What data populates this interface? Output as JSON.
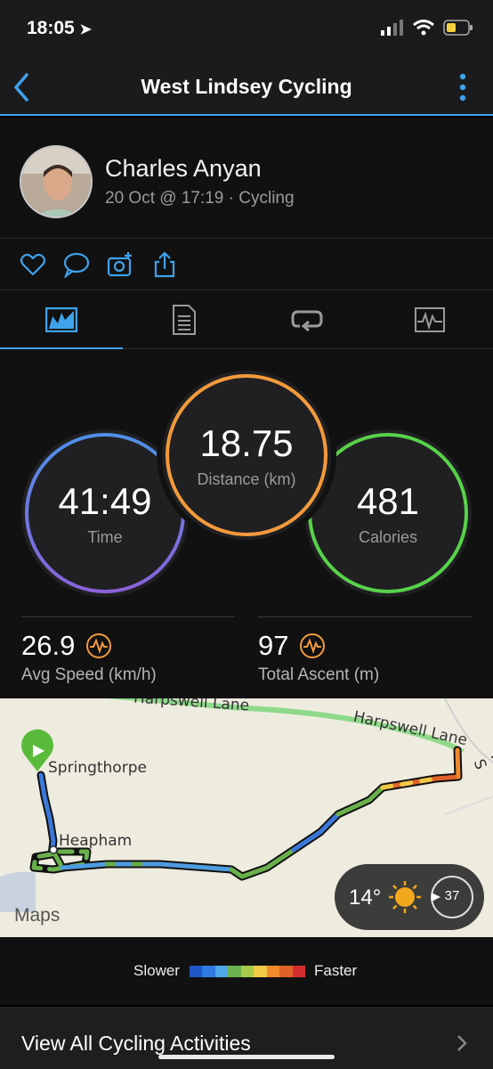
{
  "status": {
    "time": "18:05"
  },
  "nav": {
    "title": "West Lindsey Cycling"
  },
  "profile": {
    "name": "Charles Anyan",
    "subtitle": "20 Oct @ 17:19 · Cycling"
  },
  "actions": [
    "like-icon",
    "comment-icon",
    "add-photo-icon",
    "share-icon"
  ],
  "tabs": [
    {
      "name": "tab-overview",
      "icon": "map-chart-icon",
      "active": true
    },
    {
      "name": "tab-details",
      "icon": "document-icon",
      "active": false
    },
    {
      "name": "tab-laps",
      "icon": "loop-icon",
      "active": false
    },
    {
      "name": "tab-charts",
      "icon": "graph-icon",
      "active": false
    }
  ],
  "stats": {
    "time": {
      "value": "41:49",
      "label": "Time"
    },
    "distance": {
      "value": "18.75",
      "label": "Distance (km)"
    },
    "calories": {
      "value": "481",
      "label": "Calories"
    },
    "avg_speed": {
      "value": "26.9",
      "label": "Avg Speed (km/h)"
    },
    "total_ascent": {
      "value": "97",
      "label": "Total Ascent (m)"
    }
  },
  "map": {
    "road_top": "Harpswell Lane",
    "road_right": "Harpswell Lane",
    "road_edge": "Middle S",
    "place_1": "Springthorpe",
    "place_2": "Heapham",
    "attribution": "Maps",
    "weather": {
      "temp": "14°",
      "wind": "37"
    }
  },
  "legend": {
    "slower": "Slower",
    "faster": "Faster",
    "colors": [
      "#1f57c9",
      "#2f7be0",
      "#4fa8e8",
      "#6ab04c",
      "#a8c94a",
      "#f0c947",
      "#f08a2b",
      "#e0612a",
      "#d42f2f"
    ]
  },
  "footer": {
    "label": "View All Cycling Activities"
  },
  "colors": {
    "accent": "#3fa2ea",
    "time_ring": "#5b86e5",
    "distance_ring": "#f39a3c",
    "calories_ring": "#58d24a"
  }
}
